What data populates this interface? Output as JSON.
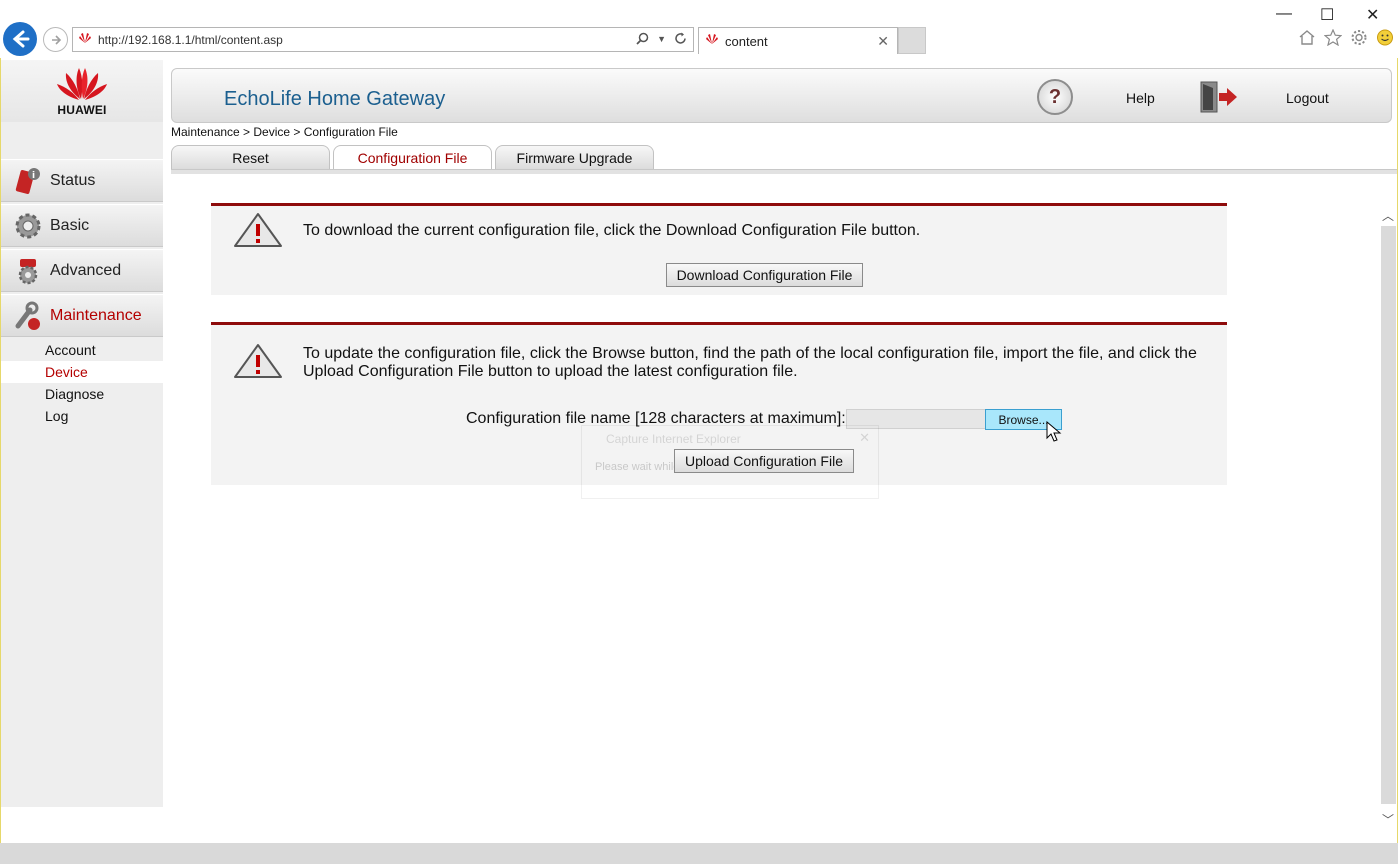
{
  "browser": {
    "url": "http://192.168.1.1/html/content.asp",
    "tab_title": "content",
    "min_glyph": "—",
    "max_glyph": "☐",
    "close_glyph": "✕",
    "tab_close_glyph": "✕",
    "icons": [
      "back-arrow-icon",
      "forward-arrow-icon",
      "search-icon",
      "refresh-icon",
      "home-icon",
      "star-icon",
      "gear-icon",
      "smiley-icon"
    ]
  },
  "logo": {
    "text": "HUAWEI"
  },
  "nav": {
    "items": [
      {
        "label": "Status",
        "icon": "status-icon",
        "active": false
      },
      {
        "label": "Basic",
        "icon": "basic-gear-icon",
        "active": false
      },
      {
        "label": "Advanced",
        "icon": "advanced-icon",
        "active": false
      },
      {
        "label": "Maintenance",
        "icon": "maintenance-icon",
        "active": true
      }
    ],
    "sub_items": [
      {
        "label": "Account",
        "active": false
      },
      {
        "label": "Device",
        "active": true
      },
      {
        "label": "Diagnose",
        "active": false
      },
      {
        "label": "Log",
        "active": false
      }
    ]
  },
  "header": {
    "title": "EchoLife Home Gateway",
    "help_label": "Help",
    "logout_label": "Logout"
  },
  "breadcrumb": "Maintenance > Device > Configuration File",
  "tabs": [
    {
      "label": "Reset",
      "active": false
    },
    {
      "label": "Configuration File",
      "active": true
    },
    {
      "label": "Firmware Upgrade",
      "active": false
    }
  ],
  "download_panel": {
    "description": "To download the current configuration file, click the Download Configuration File button.",
    "button_label": "Download Configuration File"
  },
  "upload_panel": {
    "description_line1": "To update the configuration file, click the Browse button, find the path of the local configuration file, import the file, and click the",
    "description_line2": "Upload Configuration File button to upload the latest configuration file.",
    "file_label": "Configuration file name [128 characters at maximum]:",
    "file_value": "",
    "browse_label": "Browse...",
    "upload_button_label": "Upload Configuration File"
  },
  "ghost_dialog": {
    "title": "Capture Internet Explorer",
    "message": "Please wait while the image is being captured..."
  },
  "colors": {
    "accent_red": "#b40000",
    "panel_border": "#8e0b0b",
    "title_blue": "#1b5f8f",
    "browse_bg": "#a9e7fb"
  }
}
